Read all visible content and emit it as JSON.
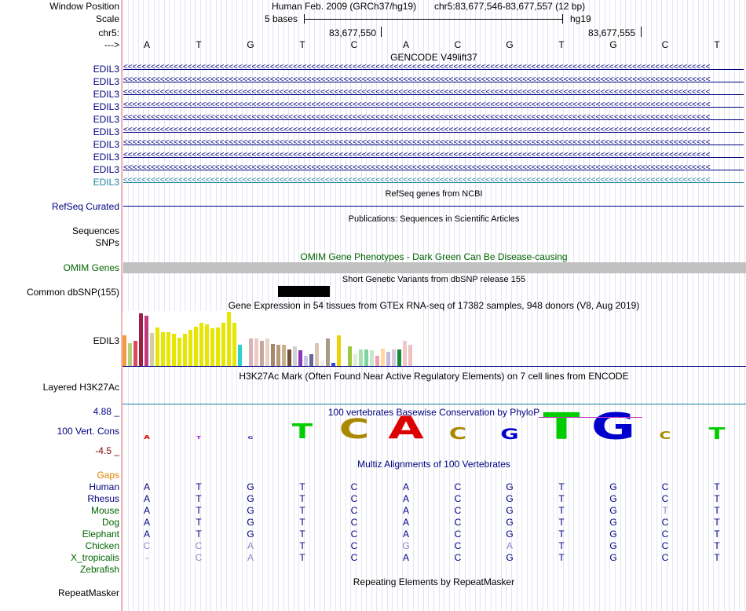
{
  "header": {
    "window_position_label": "Window Position",
    "scale_label": "Scale",
    "chr_label": "chr5:",
    "arrow_label": "--->",
    "assembly": "Human Feb. 2009 (GRCh37/hg19)",
    "position": "chr5:83,677,546-83,677,557 (12 bp)",
    "scale_text": "5 bases",
    "scale_db": "hg19",
    "coord1": "83,677,550",
    "coord2": "83,677,555"
  },
  "sequence": [
    "A",
    "T",
    "G",
    "T",
    "C",
    "A",
    "C",
    "G",
    "T",
    "G",
    "C",
    "T"
  ],
  "gencode": {
    "title": "GENCODE V49lift37",
    "rows": [
      "EDIL3",
      "EDIL3",
      "EDIL3",
      "EDIL3",
      "EDIL3",
      "EDIL3",
      "EDIL3",
      "EDIL3",
      "EDIL3",
      "EDIL3"
    ],
    "arrows": "<<<<<<<<<<<<<<<<<<<<<<<<<<<<<<<<<<<<<<<<<<<<<<<<<<<<<<<<<<<<<<<<<<<<<<<<<<<<<<<<<<<<<<<<<<<<<<<<<<<<<<<<<<<<<<<<<<<<<<<<<<<<<<<<"
  },
  "refseq": {
    "title": "RefSeq genes from NCBI",
    "label": "RefSeq Curated"
  },
  "pubs": {
    "title": "Publications: Sequences in Scientific Articles",
    "label1": "Sequences",
    "label2": "SNPs"
  },
  "omim": {
    "title": "OMIM Gene Phenotypes - Dark Green Can Be Disease-causing",
    "label": "OMIM Genes"
  },
  "dbsnp": {
    "title": "Short Genetic Variants from dbSNP release 155",
    "label": "Common dbSNP(155)"
  },
  "gtex": {
    "title": "Gene Expression in 54 tissues from GTEx RNA-seq of 17382 samples, 948 donors (V8, Aug 2019)",
    "label": "EDIL3",
    "bars": [
      {
        "v": 0.55,
        "c": "#f59a3a"
      },
      {
        "v": 0.42,
        "c": "#b5d07a"
      },
      {
        "v": 0.45,
        "c": "#d94a5a"
      },
      {
        "v": 0.95,
        "c": "#992244"
      },
      {
        "v": 0.92,
        "c": "#c23a7a"
      },
      {
        "v": 0.6,
        "c": "#cfcfa8"
      },
      {
        "v": 0.7,
        "c": "#e6e600"
      },
      {
        "v": 0.62,
        "c": "#e6e600"
      },
      {
        "v": 0.62,
        "c": "#e6e600"
      },
      {
        "v": 0.58,
        "c": "#e6e600"
      },
      {
        "v": 0.52,
        "c": "#e6e600"
      },
      {
        "v": 0.58,
        "c": "#e6e600"
      },
      {
        "v": 0.65,
        "c": "#e6e600"
      },
      {
        "v": 0.72,
        "c": "#e6e600"
      },
      {
        "v": 0.78,
        "c": "#e6e600"
      },
      {
        "v": 0.75,
        "c": "#e6e600"
      },
      {
        "v": 0.68,
        "c": "#e6e600"
      },
      {
        "v": 0.7,
        "c": "#e6e600"
      },
      {
        "v": 0.78,
        "c": "#e6e600"
      },
      {
        "v": 0.98,
        "c": "#e6e600"
      },
      {
        "v": 0.78,
        "c": "#e6e600"
      },
      {
        "v": 0.38,
        "c": "#2ad1cf"
      },
      {
        "v": 0.0,
        "c": "#ffffff"
      },
      {
        "v": 0.5,
        "c": "#d9b3b3"
      },
      {
        "v": 0.5,
        "c": "#f0c8c8"
      },
      {
        "v": 0.45,
        "c": "#c9a89a"
      },
      {
        "v": 0.5,
        "c": "#e8d3c8"
      },
      {
        "v": 0.4,
        "c": "#a8866a"
      },
      {
        "v": 0.38,
        "c": "#b59a7a"
      },
      {
        "v": 0.38,
        "c": "#c9b08a"
      },
      {
        "v": 0.3,
        "c": "#6f4f3a"
      },
      {
        "v": 0.35,
        "c": "#d2d2d2"
      },
      {
        "v": 0.28,
        "c": "#8a3ab9"
      },
      {
        "v": 0.18,
        "c": "#c7c7e6"
      },
      {
        "v": 0.22,
        "c": "#666699"
      },
      {
        "v": 0.42,
        "c": "#d8c8b0"
      },
      {
        "v": 0.1,
        "c": "#ededed"
      },
      {
        "v": 0.5,
        "c": "#a89b85"
      },
      {
        "v": 0.05,
        "c": "#2a4ad9"
      },
      {
        "v": 0.55,
        "c": "#f0d000"
      },
      {
        "v": 0.08,
        "c": "#ffffff"
      },
      {
        "v": 0.35,
        "c": "#9ac83a"
      },
      {
        "v": 0.22,
        "c": "#d9f0d9"
      },
      {
        "v": 0.3,
        "c": "#a8e0b0"
      },
      {
        "v": 0.3,
        "c": "#7ad3a0"
      },
      {
        "v": 0.28,
        "c": "#c8e8c8"
      },
      {
        "v": 0.18,
        "c": "#f0a0b0"
      },
      {
        "v": 0.32,
        "c": "#ffd9a0"
      },
      {
        "v": 0.25,
        "c": "#c9b8d9"
      },
      {
        "v": 0.3,
        "c": "#d9c8e0"
      },
      {
        "v": 0.3,
        "c": "#178a3a"
      },
      {
        "v": 0.45,
        "c": "#f0c8c8"
      },
      {
        "v": 0.38,
        "c": "#f0c0c0"
      },
      {
        "v": 0.0,
        "c": "#ffffff"
      }
    ]
  },
  "h3k27ac": {
    "title": "H3K27Ac Mark (Often Found Near Active Regulatory Elements) on 7 cell lines from ENCODE",
    "label": "Layered H3K27Ac"
  },
  "phylop": {
    "title": "100 vertebrates Basewise Conservation by PhyloP",
    "label": "100 Vert. Cons",
    "max": "4.88 _",
    "min": "-4.5 _",
    "logo": [
      {
        "b": "A",
        "c": "#dd0000",
        "h": 0.15
      },
      {
        "b": "T",
        "c": "#aa00cc",
        "h": 0.08
      },
      {
        "b": "G",
        "c": "#5522aa",
        "h": 0.06
      },
      {
        "b": "T",
        "c": "#00cc00",
        "h": 0.55
      },
      {
        "b": "C",
        "c": "#aa8800",
        "h": 0.75
      },
      {
        "b": "A",
        "c": "#dd0000",
        "h": 0.85
      },
      {
        "b": "C",
        "c": "#aa8800",
        "h": 0.45
      },
      {
        "b": "G",
        "c": "#0000cc",
        "h": 0.4
      },
      {
        "b": "T",
        "c": "#00cc00",
        "h": 1.0
      },
      {
        "b": "G",
        "c": "#0000cc",
        "h": 1.0
      },
      {
        "b": "C",
        "c": "#aa8800",
        "h": 0.3
      },
      {
        "b": "T",
        "c": "#00cc00",
        "h": 0.45
      }
    ]
  },
  "multiz": {
    "title": "Multiz Alignments of 100 Vertebrates",
    "gaps": "Gaps",
    "species": [
      {
        "name": "Human",
        "color": "#000080",
        "seq": [
          "A",
          "T",
          "G",
          "T",
          "C",
          "A",
          "C",
          "G",
          "T",
          "G",
          "C",
          "T"
        ],
        "dim": []
      },
      {
        "name": "Rhesus",
        "color": "#000080",
        "seq": [
          "A",
          "T",
          "G",
          "T",
          "C",
          "A",
          "C",
          "G",
          "T",
          "G",
          "C",
          "T"
        ],
        "dim": []
      },
      {
        "name": "Mouse",
        "color": "#006400",
        "seq": [
          "A",
          "T",
          "G",
          "T",
          "C",
          "A",
          "C",
          "G",
          "T",
          "G",
          "T",
          "T"
        ],
        "dim": [
          10
        ]
      },
      {
        "name": "Dog",
        "color": "#006400",
        "seq": [
          "A",
          "T",
          "G",
          "T",
          "C",
          "A",
          "C",
          "G",
          "T",
          "G",
          "C",
          "T"
        ],
        "dim": []
      },
      {
        "name": "Elephant",
        "color": "#006400",
        "seq": [
          "A",
          "T",
          "G",
          "T",
          "C",
          "A",
          "C",
          "G",
          "T",
          "G",
          "C",
          "T"
        ],
        "dim": []
      },
      {
        "name": "Chicken",
        "color": "#006400",
        "seq": [
          "C",
          "C",
          "A",
          "T",
          "C",
          "G",
          "C",
          "A",
          "T",
          "G",
          "C",
          "T"
        ],
        "dim": [
          0,
          1,
          2,
          5,
          7
        ]
      },
      {
        "name": "X_tropicalis",
        "color": "#006400",
        "seq": [
          "-",
          "C",
          "A",
          "T",
          "C",
          "A",
          "C",
          "G",
          "T",
          "G",
          "C",
          "T"
        ],
        "dim": [
          0,
          1,
          2
        ]
      },
      {
        "name": "Zebrafish",
        "color": "#006400",
        "seq": [
          "",
          "",
          "",
          "",
          "",
          "",
          "",
          "",
          "",
          "",
          "",
          ""
        ],
        "dim": []
      }
    ]
  },
  "repeats": {
    "title": "Repeating Elements by RepeatMasker",
    "label": "RepeatMasker"
  },
  "colors": {
    "navy": "#000080",
    "omim_gray": "#c0c0c0",
    "label_green": "#006400",
    "gaps_orange": "#e08000",
    "last_edil3": "#2080a0"
  }
}
